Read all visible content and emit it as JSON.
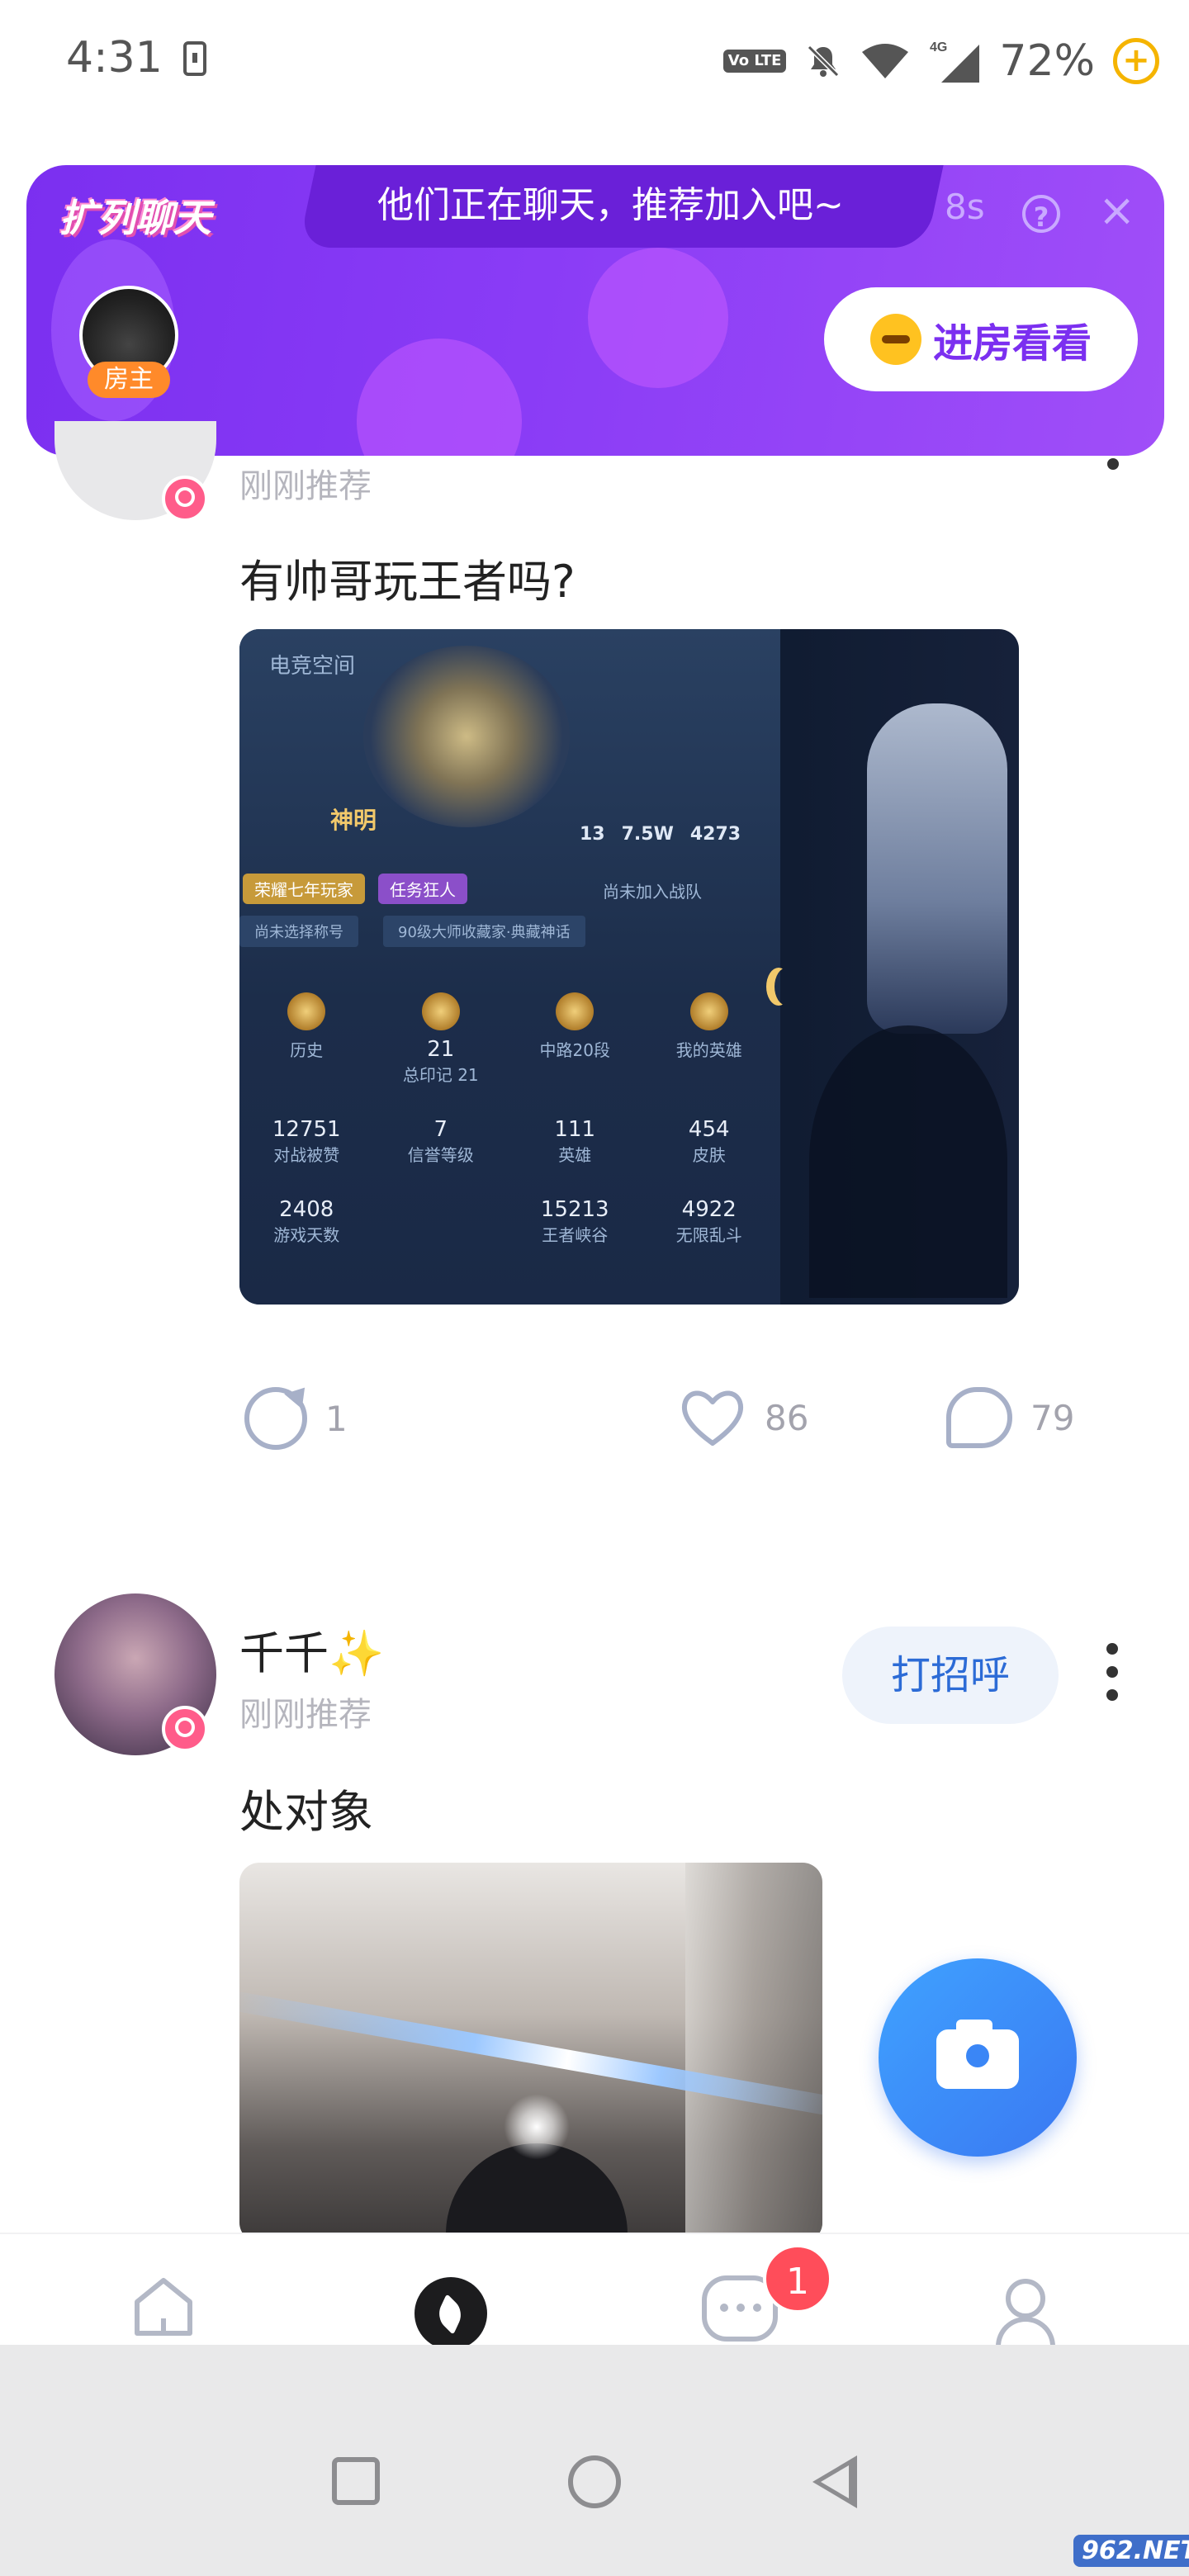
{
  "status_bar": {
    "time": "4:31",
    "network": "4G",
    "volte": "Vo LTE",
    "battery": "72%"
  },
  "banner": {
    "tag": "扩列聊天",
    "headline": "他们正在聊天，推荐加入吧~",
    "timer": "8s",
    "help": "?",
    "close": "×",
    "host_label": "房主",
    "join_button": "进房看看",
    "colors": {
      "bg": "#7b2ff0",
      "accent": "#ff8a2a"
    }
  },
  "post1": {
    "time": "刚刚推荐",
    "text": "有帅哥玩王者吗?",
    "game": {
      "title": "电竞空间",
      "player_name": "神明",
      "stats": [
        "13",
        "7.5W",
        "4273"
      ],
      "tags": [
        "荣耀七年玩家",
        "任务狂人"
      ],
      "team": "尚未加入战队",
      "row2": [
        "尚未选择称号",
        "90级大师收藏家·典藏神话"
      ],
      "grid": [
        {
          "value": "",
          "label": "历史"
        },
        {
          "value": "21",
          "label": "总印记 21"
        },
        {
          "value": "",
          "label": "中路20段"
        },
        {
          "value": "",
          "label": "我的英雄"
        },
        {
          "value": "12751",
          "label": "对战被赞"
        },
        {
          "value": "7",
          "label": "信誉等级"
        },
        {
          "value": "111",
          "label": "英雄"
        },
        {
          "value": "454",
          "label": "皮肤"
        },
        {
          "value": "2408",
          "label": "游戏天数"
        },
        {
          "value": "",
          "label": ""
        },
        {
          "value": "15213",
          "label": "王者峡谷"
        },
        {
          "value": "4922",
          "label": "无限乱斗"
        }
      ]
    },
    "shares": "1",
    "likes": "86",
    "comments": "79"
  },
  "post2": {
    "name": "千千✨",
    "time": "刚刚推荐",
    "greet_button": "打招呼",
    "text": "处对象"
  },
  "tabs": {
    "message_badge": "1"
  },
  "watermark": "962.NET"
}
